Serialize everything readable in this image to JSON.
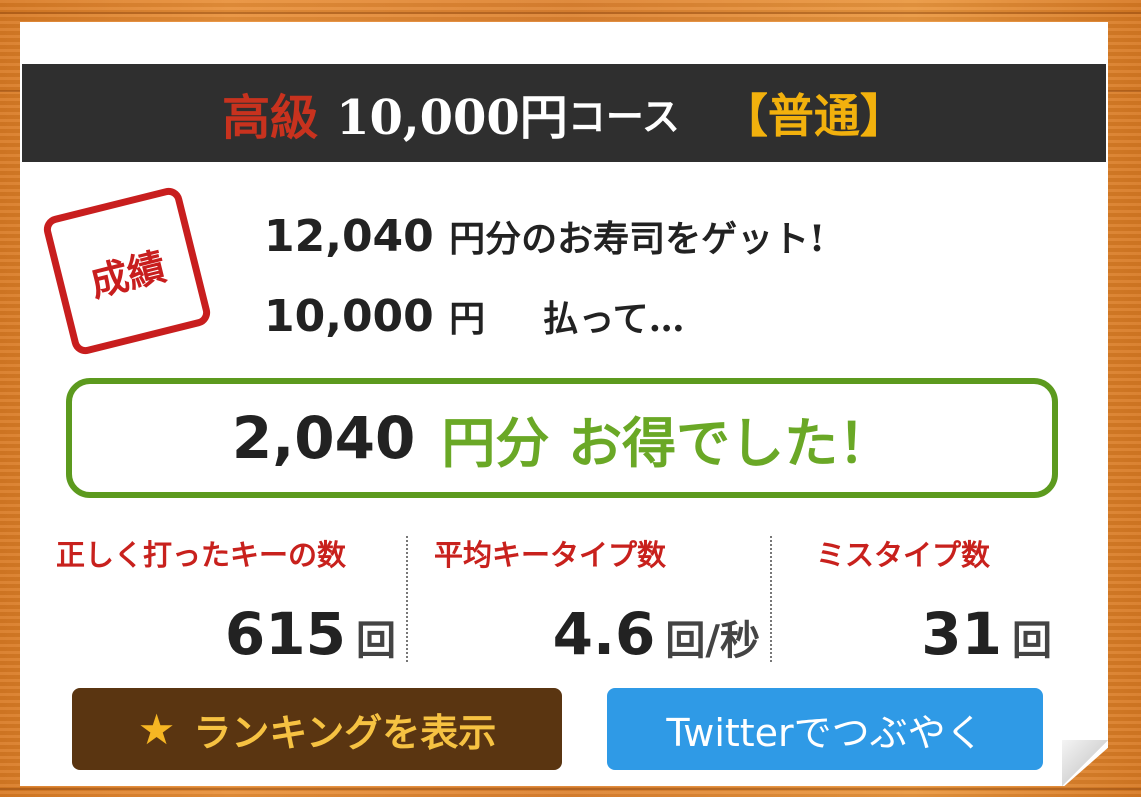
{
  "header": {
    "grade": "高級",
    "amount": "10,000円",
    "course": "コース",
    "level": "【普通】"
  },
  "stamp": "成績",
  "summary": {
    "earned_value": "12,040",
    "earned_text": "円分のお寿司をゲット!",
    "paid_value": "10,000",
    "paid_unit": "円",
    "paid_text": "払って…"
  },
  "result": {
    "value": "2,040",
    "text": "円分 お得でした！"
  },
  "stats": [
    {
      "label": "正しく打ったキーの数",
      "value": "615",
      "unit": "回"
    },
    {
      "label": "平均キータイプ数",
      "value": "4.6",
      "unit": "回/秒"
    },
    {
      "label": "ミスタイプ数",
      "value": "31",
      "unit": "回"
    }
  ],
  "buttons": {
    "ranking": "ランキングを表示",
    "twitter": "Twitterでつぶやく"
  },
  "colors": {
    "header_bg": "#2f2f2f",
    "grade": "#c8321e",
    "level": "#f2b10d",
    "stamp": "#c81e1e",
    "result_border": "#5c9a1e",
    "result_text": "#6aa826",
    "stat_label": "#c8211d",
    "ranking_bg": "#5a3511",
    "twitter_bg": "#2f9ae6"
  },
  "icons": {
    "ranking": "star-icon"
  }
}
